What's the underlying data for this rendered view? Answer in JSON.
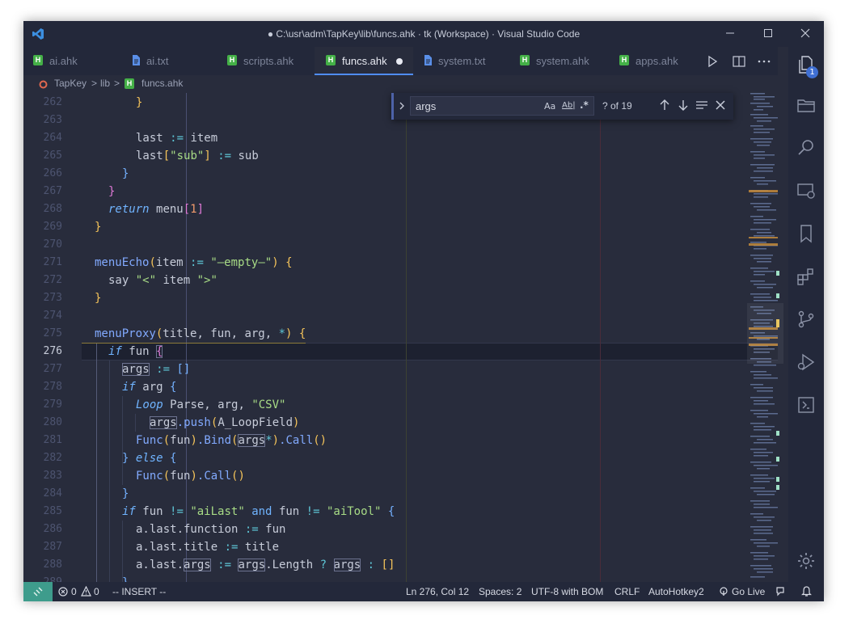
{
  "window": {
    "title": "● C:\\usr\\adm\\TapKey\\lib\\funcs.ahk · tk (Workspace) · Visual Studio Code"
  },
  "tabs": [
    {
      "label": "ai.ahk",
      "icon": "ahk-file-icon"
    },
    {
      "label": "ai.txt",
      "icon": "text-file-icon"
    },
    {
      "label": "scripts.ahk",
      "icon": "ahk-file-icon"
    },
    {
      "label": "funcs.ahk",
      "icon": "ahk-file-icon",
      "active": true,
      "modified": true
    },
    {
      "label": "system.txt",
      "icon": "text-file-icon"
    },
    {
      "label": "system.ahk",
      "icon": "ahk-file-icon"
    },
    {
      "label": "apps.ahk",
      "icon": "ahk-file-icon"
    }
  ],
  "file_icon_letter": "H",
  "breadcrumb": {
    "root": "TapKey",
    "sep": ">",
    "folder": "lib",
    "file": "funcs.ahk"
  },
  "find": {
    "query": "args",
    "count": "? of 19",
    "match_case": "Aa",
    "whole_word": "Ab|",
    "regex": ".*"
  },
  "editor": {
    "current_line": 276,
    "lines": [
      262,
      263,
      264,
      265,
      266,
      267,
      268,
      269,
      270,
      271,
      272,
      273,
      274,
      275,
      276,
      277,
      278,
      279,
      280,
      281,
      282,
      283,
      284,
      285,
      286,
      287,
      288,
      289
    ],
    "code": {
      "l262": "}",
      "l264_a": "last",
      "l264_b": ":=",
      "l264_c": "item",
      "l265_a": "last",
      "l265_b": "[",
      "l265_c": "\"sub\"",
      "l265_d": "]",
      "l265_e": ":=",
      "l265_f": "sub",
      "l266": "}",
      "l267": "}",
      "l268_a": "return",
      "l268_b": "menu",
      "l268_c": "[",
      "l268_d": "1",
      "l268_e": "]",
      "l269": "}",
      "l271_a": "menuEcho",
      "l271_b": "(",
      "l271_c": "item",
      "l271_d": ":=",
      "l271_e": "\"—empty—\"",
      "l271_f": ")",
      "l271_g": "{",
      "l272_a": "say",
      "l272_b": "\"<\"",
      "l272_c": "item",
      "l272_d": "\">\"",
      "l273": "}",
      "l275_a": "menuProxy",
      "l275_b": "(",
      "l275_c": "title, fun, arg,",
      "l275_d": "*",
      "l275_e": ")",
      "l275_f": "{",
      "l276_a": "if",
      "l276_b": "fun",
      "l276_c": "{",
      "l277_a": "args",
      "l277_b": ":=",
      "l277_c": "[]",
      "l278_a": "if",
      "l278_b": "arg",
      "l278_c": "{",
      "l279_a": "Loop",
      "l279_b": "Parse, arg,",
      "l279_c": "\"CSV\"",
      "l280_a": "args",
      "l280_b": ".push",
      "l280_c": "(",
      "l280_d": "A_LoopField",
      "l280_e": ")",
      "l281_a": "Func",
      "l281_b": "(",
      "l281_c": "fun",
      "l281_d": ")",
      "l281_e": ".Bind",
      "l281_f": "(",
      "l281_g": "args",
      "l281_h": "*",
      "l281_i": ")",
      "l281_j": ".Call",
      "l281_k": "()",
      "l282_a": "}",
      "l282_b": "else",
      "l282_c": "{",
      "l283_a": "Func",
      "l283_b": "(",
      "l283_c": "fun",
      "l283_d": ")",
      "l283_e": ".Call",
      "l283_f": "()",
      "l284": "}",
      "l285_a": "if",
      "l285_b": "fun",
      "l285_c": "!=",
      "l285_d": "\"aiLast\"",
      "l285_e": "and",
      "l285_f": "fun",
      "l285_g": "!=",
      "l285_h": "\"aiTool\"",
      "l285_i": "{",
      "l286_a": "a.last.function",
      "l286_b": ":=",
      "l286_c": "fun",
      "l287_a": "a.last.title",
      "l287_b": ":=",
      "l287_c": "title",
      "l288_a": "a.last.",
      "l288_b": "args",
      "l288_c": ":=",
      "l288_d": "args",
      "l288_e": ".Length",
      "l288_f": "?",
      "l288_g": "args",
      "l288_h": ":",
      "l288_i": "[]",
      "l289": "}"
    }
  },
  "activity": {
    "explorer_badge": "1"
  },
  "status": {
    "errors": "0",
    "warnings": "0",
    "mode": "-- INSERT --",
    "position": "Ln 276, Col 12",
    "spaces": "Spaces: 2",
    "encoding": "UTF-8 with BOM",
    "eol": "CRLF",
    "language": "AutoHotkey2",
    "golive": "Go Live"
  },
  "colors": {
    "background": "#282c3c",
    "chrome": "#23283a",
    "remote": "#3e9c8c",
    "accent": "#4f8cf5",
    "ahk_icon": "#44b047"
  }
}
